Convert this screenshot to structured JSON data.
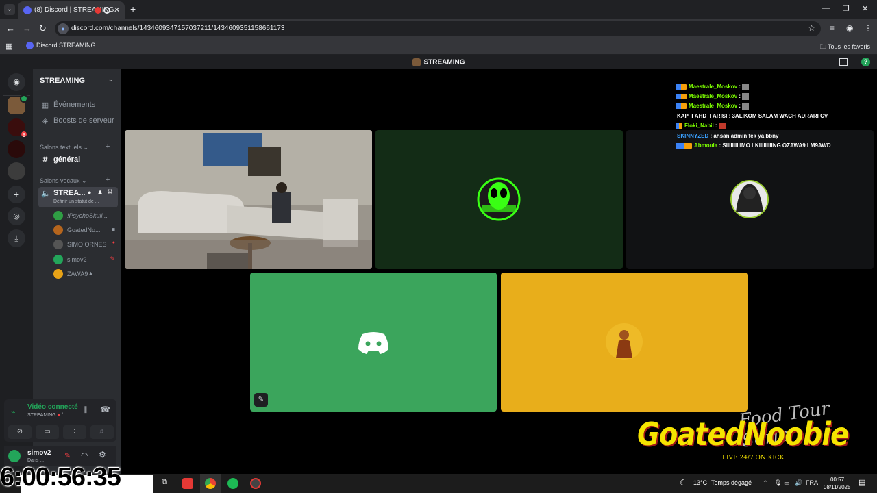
{
  "browser": {
    "tab_title": "(8) Discord | STREAMING",
    "url": "discord.com/channels/1434609347157037211/1434609351158661173",
    "bookmark_label": "Discord STREAMING",
    "all_favorites_label": "Tous les favoris"
  },
  "discord": {
    "top_title": "STREAMING",
    "server_name": "STREAMING",
    "menu_events": "Événements",
    "menu_boosts": "Boosts de serveur",
    "text_category": "Salons textuels",
    "text_channel": "général",
    "voice_category": "Salons vocaux",
    "voice_channel": "STREA...",
    "voice_status": "Définir un statut de ...",
    "voice_users": [
      {
        "name": "!PsychoSkull...",
        "color": "#2f9e44"
      },
      {
        "name": "GoatedNo...",
        "color": "#b5651d"
      },
      {
        "name": "SIMO ORNES",
        "color": "#555555"
      },
      {
        "name": "simov2",
        "color": "#23a55a"
      },
      {
        "name": "ZAWA9",
        "color": "#e8a317"
      }
    ],
    "voice_connected": "Vidéo connecté",
    "voice_connected_sub": "STREAMING",
    "voice_connected_sub2": "/ ...",
    "user_name": "simov2",
    "user_status": "Dans ...",
    "guild_badge": "8"
  },
  "chat": [
    {
      "user": "Maestrale_Moskov",
      "msg": ":",
      "color": "#7CFC00"
    },
    {
      "user": "Maestrale_Moskov",
      "msg": ":",
      "color": "#7CFC00"
    },
    {
      "user": "Maestrale_Moskov",
      "msg": ":",
      "color": "#7CFC00"
    },
    {
      "user": "KAP_FAHD_FARISI",
      "msg": ": 3ALIKOM SALAM WACH ADRARI CV",
      "color": "#ffffff"
    },
    {
      "user": "Floki_Nabil",
      "msg": ":",
      "color": "#7CFC00"
    },
    {
      "user": "SKINNYZED",
      "msg": ": ahsan admin fek ya bbny",
      "color": "#3aa0ff"
    },
    {
      "user": "Abmoula",
      "msg": ": SIIIIIIIIIIMO LKIIIIIIIIING OZAWA9 LM9AWD",
      "color": "#7CFC00"
    }
  ],
  "overlay": {
    "timer": "6:00:56:35",
    "watermark_name": "GoatedNoobie",
    "watermark_sub": "LIVE 24/7 ON KICK",
    "watermark_script": "Food Tour Seric"
  },
  "taskbar": {
    "temperature": "13°C",
    "weather": "Temps dégagé",
    "lang": "FRA",
    "time": "00:57",
    "date": "08/11/2025"
  },
  "colors": {
    "tile_alien": "#132c16",
    "tile_dark": "#111214",
    "tile_green": "#3ba55c",
    "tile_yellow": "#e8ae1b"
  }
}
